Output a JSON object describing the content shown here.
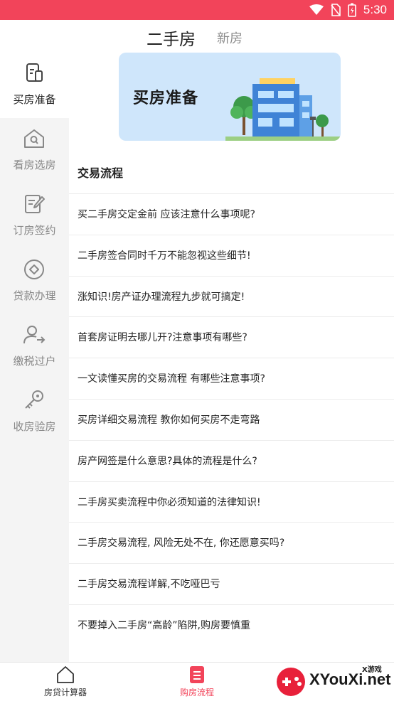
{
  "status_bar": {
    "time": "5:30",
    "icons": [
      "wifi-icon",
      "no-sim-icon",
      "battery-icon"
    ]
  },
  "top_tabs": {
    "active": "二手房",
    "inactive": "新房"
  },
  "sidebar": {
    "items": [
      {
        "label": "买房准备",
        "icon": "document-icon",
        "active": true
      },
      {
        "label": "看房选房",
        "icon": "house-search-icon",
        "active": false
      },
      {
        "label": "订房签约",
        "icon": "sign-contract-icon",
        "active": false
      },
      {
        "label": "贷款办理",
        "icon": "loan-icon",
        "active": false
      },
      {
        "label": "缴税过户",
        "icon": "user-transfer-icon",
        "active": false
      },
      {
        "label": "收房验房",
        "icon": "key-icon",
        "active": false
      }
    ]
  },
  "banner": {
    "title": "买房准备"
  },
  "section": {
    "title": "交易流程"
  },
  "articles": [
    "买二手房交定金前 应该注意什么事项呢?",
    "二手房签合同时千万不能忽视这些细节!",
    "涨知识!房产证办理流程九步就可搞定!",
    "首套房证明去哪儿开?注意事项有哪些?",
    "一文读懂买房的交易流程 有哪些注意事项?",
    "买房详细交易流程 教你如何买房不走弯路",
    "房产网签是什么意思?具体的流程是什么?",
    "二手房买卖流程中你必须知道的法律知识!",
    "二手房交易流程, 风险无处不在, 你还愿意买吗?",
    "二手房交易流程详解,不吃哑巴亏",
    "不要掉入二手房“高龄”陷阱,购房要慎重"
  ],
  "bottom_nav": {
    "items": [
      {
        "label": "房贷计算器",
        "icon": "house-icon",
        "active": false
      },
      {
        "label": "购房流程",
        "icon": "list-doc-icon",
        "active": true
      }
    ]
  },
  "watermark": {
    "text": "XYouXi.net",
    "small": "X游戏"
  },
  "colors": {
    "accent": "#f2445a",
    "sidebar_bg": "#f4f4f4",
    "banner_bg": "#cfe6fb"
  }
}
